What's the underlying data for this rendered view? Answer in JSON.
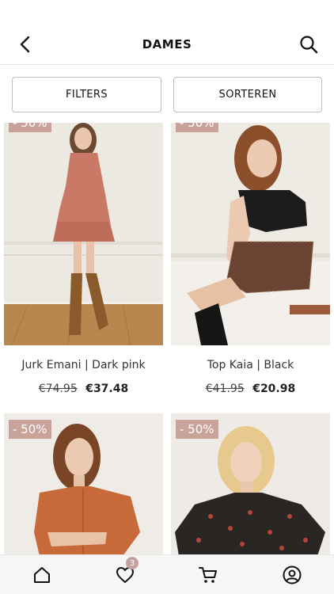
{
  "header": {
    "title": "DAMES",
    "back_icon": "chevron-left-icon",
    "search_icon": "search-icon"
  },
  "filters": {
    "filters_label": "FILTERS",
    "sort_label": "SORTEREN"
  },
  "products": [
    {
      "name": "Jurk Emani | Dark pink",
      "old_price": "€74.95",
      "new_price": "€37.48",
      "badge": "- 50%"
    },
    {
      "name": "Top Kaia | Black",
      "old_price": "€41.95",
      "new_price": "€20.98",
      "badge": "- 50%"
    },
    {
      "name": "",
      "old_price": "",
      "new_price": "",
      "badge": "- 50%"
    },
    {
      "name": "",
      "old_price": "",
      "new_price": "",
      "badge": "- 50%"
    }
  ],
  "tabbar": {
    "wishlist_count": "3",
    "icons": [
      "home-icon",
      "heart-icon",
      "cart-icon",
      "account-icon"
    ]
  },
  "colors": {
    "badge": "#c9a39a",
    "count_badge": "#c4a39e",
    "tabbar_bg": "#f6f6f6"
  }
}
